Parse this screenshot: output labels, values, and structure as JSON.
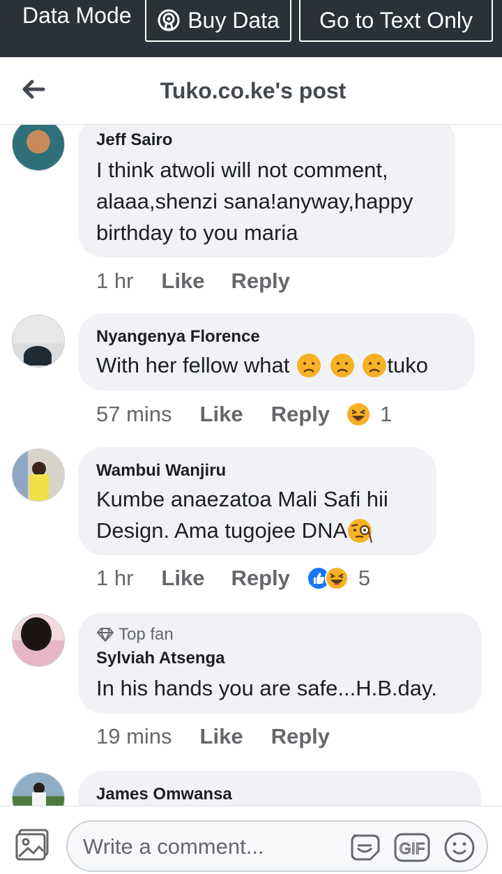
{
  "topbar": {
    "mode_label": "Data Mode",
    "buy_label": "Buy Data",
    "text_only_label": "Go to Text Only"
  },
  "header": {
    "title": "Tuko.co.ke's post"
  },
  "comments": [
    {
      "name": "Jeff Sairo",
      "lines": [
        "I think atwoli will not comment,",
        "alaaa,shenzi sana!anyway,happy",
        "birthday to you maria"
      ],
      "time": "1 hr",
      "like": "Like",
      "reply": "Reply"
    },
    {
      "name": "Nyangenya Florence",
      "text_before": "With her fellow what",
      "text_after": "tuko",
      "time": "57 mins",
      "like": "Like",
      "reply": "Reply",
      "reaction_count": "1"
    },
    {
      "name": "Wambui Wanjiru",
      "lines": [
        "Kumbe anaezatoa Mali  Safi hii",
        "Design.  Ama tugojee DNA"
      ],
      "time": "1 hr",
      "like": "Like",
      "reply": "Reply",
      "reaction_count": "5"
    },
    {
      "badge": "Top fan",
      "name": "Sylviah Atsenga",
      "text": "In his hands you are safe...H.B.day.",
      "time": "19 mins",
      "like": "Like",
      "reply": "Reply"
    },
    {
      "name": "James Omwansa"
    }
  ],
  "composer": {
    "placeholder": "Write a comment..."
  },
  "colors": {
    "topbar_bg": "#2b3139",
    "bubble_bg": "#f0f2f5",
    "like_blue": "#1877f2",
    "emoji_yellow": "#f7b125"
  }
}
